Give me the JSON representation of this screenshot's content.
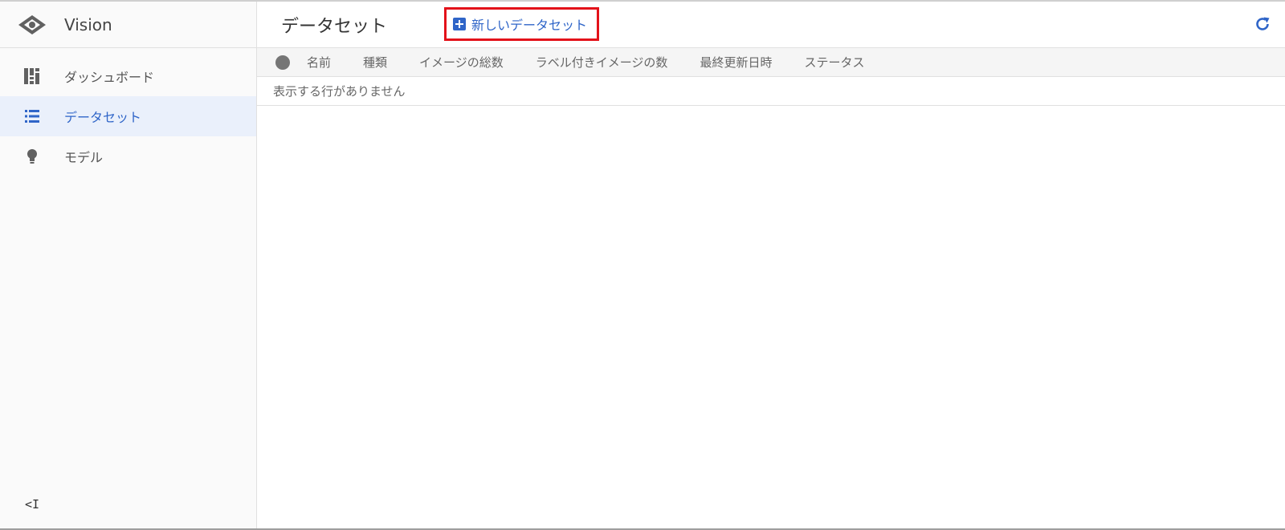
{
  "app": {
    "name": "Vision"
  },
  "sidebar": {
    "items": [
      {
        "label": "ダッシュボード",
        "icon": "dashboard-icon"
      },
      {
        "label": "データセット",
        "icon": "list-icon",
        "active": true
      },
      {
        "label": "モデル",
        "icon": "lightbulb-icon"
      }
    ],
    "collapse_label": "<I"
  },
  "header": {
    "title": "データセット",
    "new_dataset_label": "新しいデータセット",
    "refresh_icon": "refresh-icon"
  },
  "table": {
    "columns": [
      "名前",
      "種類",
      "イメージの総数",
      "ラベル付きイメージの数",
      "最終更新日時",
      "ステータス"
    ],
    "empty_message": "表示する行がありません"
  },
  "colors": {
    "accent": "#2f65c8",
    "highlight_border": "#e3121a",
    "active_bg": "#eaf0fb"
  }
}
